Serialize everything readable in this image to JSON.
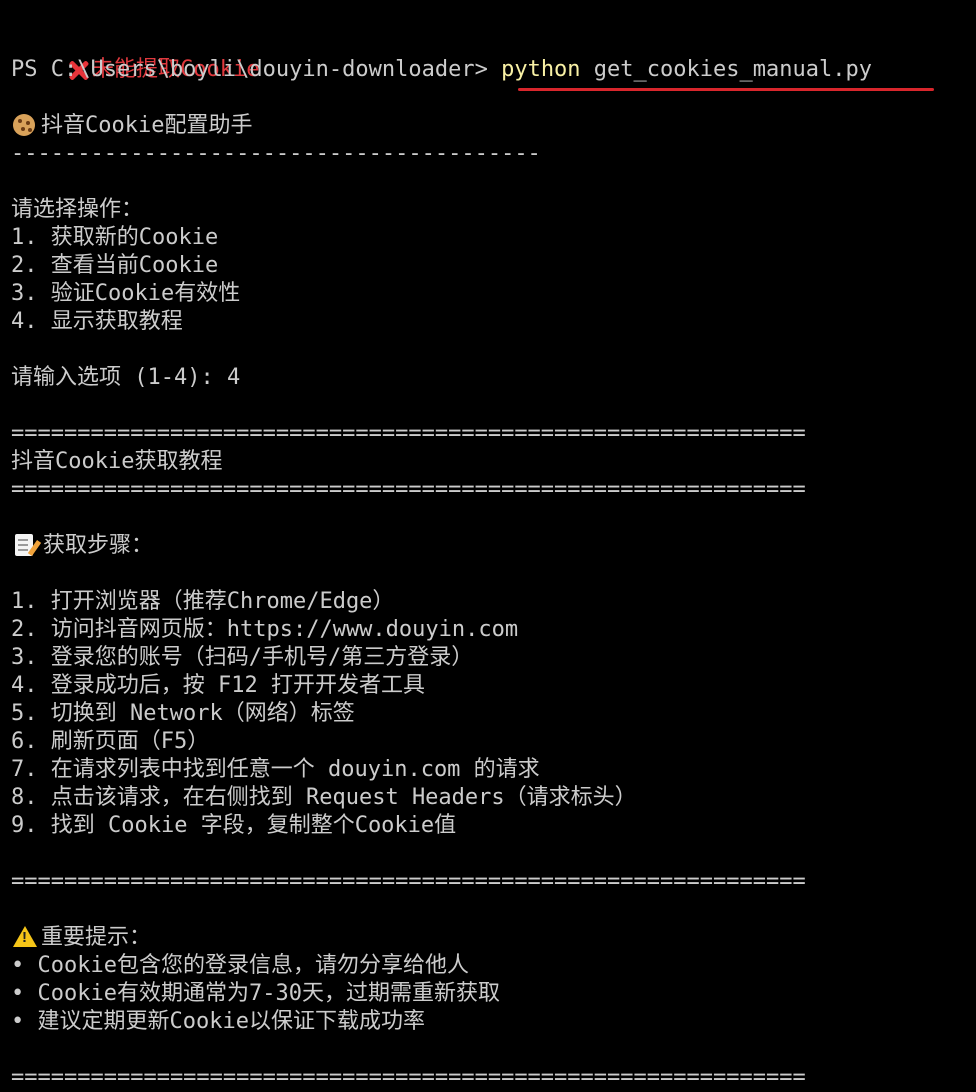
{
  "colors": {
    "background": "#000000",
    "text": "#cccccc",
    "error": "#e0393e",
    "command": "#f9f1a5",
    "annotation_underline": "#d8262c"
  },
  "error_line": {
    "icon": "cross-mark-icon",
    "text": "未能提取Cookie"
  },
  "prompt": {
    "path": "PS C:\\Users\\boyli\\douyin-downloader> ",
    "command": "python",
    "args": " get_cookies_manual.py"
  },
  "header": {
    "icon": "cookie-icon",
    "title": "抖音Cookie配置助手",
    "rule": "----------------------------------------"
  },
  "menu": {
    "prompt": "请选择操作：",
    "options": [
      "1. 获取新的Cookie",
      "2. 查看当前Cookie",
      "3. 验证Cookie有效性",
      "4. 显示获取教程"
    ]
  },
  "input": {
    "prompt": "请输入选项 (1-4): ",
    "value": "4"
  },
  "tutorial": {
    "rule": "============================================================",
    "title": "抖音Cookie获取教程",
    "steps_icon": "memo-icon",
    "steps_heading": "获取步骤：",
    "steps": [
      "1. 打开浏览器（推荐Chrome/Edge）",
      "2. 访问抖音网页版：https://www.douyin.com",
      "3. 登录您的账号（扫码/手机号/第三方登录）",
      "4. 登录成功后，按 F12 打开开发者工具",
      "5. 切换到 Network（网络）标签",
      "6. 刷新页面（F5）",
      "7. 在请求列表中找到任意一个 douyin.com 的请求",
      "8. 点击该请求，在右侧找到 Request Headers（请求标头）",
      "9. 找到 Cookie 字段，复制整个Cookie值"
    ],
    "warning_icon": "warning-icon",
    "warning_heading": "重要提示：",
    "tips": [
      "• Cookie包含您的登录信息，请勿分享给他人",
      "• Cookie有效期通常为7-30天，过期需重新获取",
      "• 建议定期更新Cookie以保证下载成功率"
    ]
  }
}
